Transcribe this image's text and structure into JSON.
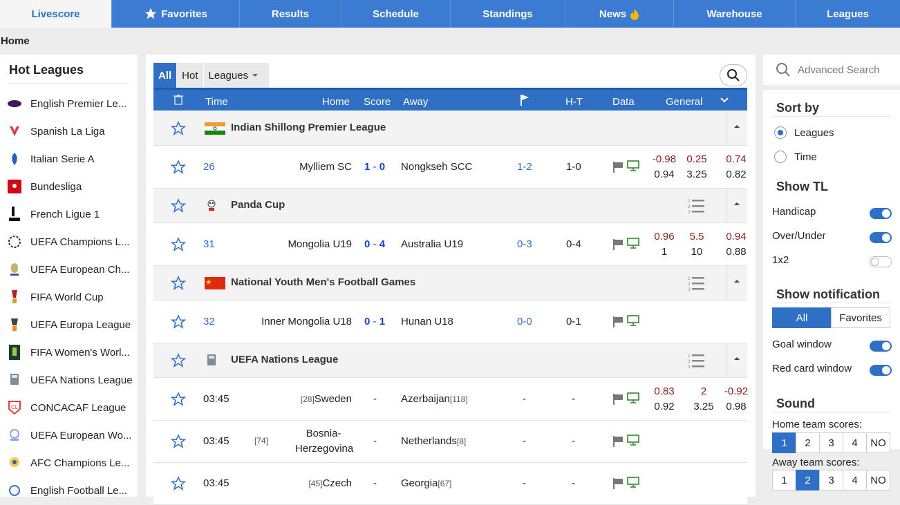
{
  "nav": {
    "tabs": [
      "Livescore",
      "Favorites",
      "Results",
      "Schedule",
      "Standings",
      "News",
      "Warehouse",
      "Leagues"
    ]
  },
  "breadcrumb": "Home",
  "sidebar": {
    "title": "Hot Leagues",
    "leagues": [
      "English Premier Le...",
      "Spanish La Liga",
      "Italian Serie A",
      "Bundesliga",
      "French Ligue 1",
      "UEFA Champions L...",
      "UEFA European Ch...",
      "FIFA World Cup",
      "UEFA Europa League",
      "FIFA Women's Worl...",
      "UEFA Nations League",
      "CONCACAF League",
      "UEFA European Wo...",
      "AFC Champions Le...",
      "English Football Le..."
    ]
  },
  "filters": {
    "all": "All",
    "hot": "Hot",
    "leagues": "Leagues"
  },
  "table_header": {
    "time": "Time",
    "home": "Home",
    "score": "Score",
    "away": "Away",
    "ht": "H-T",
    "data": "Data",
    "general": "General"
  },
  "groups": [
    {
      "name": "Indian Shillong Premier League",
      "match": {
        "time": "26",
        "home": "Mylliem SC",
        "score_home": "1",
        "score_away": "0",
        "dash": "-",
        "away": "Nongkseh SCC",
        "corner": "1-2",
        "ht": "1-0",
        "odds": [
          [
            "-0.98",
            "0.25",
            "0.74"
          ],
          [
            "0.94",
            "3.25",
            "0.82"
          ]
        ]
      }
    },
    {
      "name": "Panda Cup",
      "match": {
        "time": "31",
        "home": "Mongolia U19",
        "score_home": "0",
        "score_away": "4",
        "dash": "-",
        "away": "Australia U19",
        "corner": "0-3",
        "ht": "0-4",
        "odds": [
          [
            "0.96",
            "5.5",
            "0.94"
          ],
          [
            "1",
            "10",
            "0.88"
          ]
        ]
      }
    },
    {
      "name": "National Youth Men's Football Games",
      "match": {
        "time": "32",
        "home": "Inner Mongolia U18",
        "score_home": "0",
        "score_away": "1",
        "dash": "-",
        "away": "Hunan U18",
        "corner": "0-0",
        "ht": "0-1"
      }
    },
    {
      "name": "UEFA Nations League"
    }
  ],
  "nations_matches": [
    {
      "time": "03:45",
      "home_rank": "[28]",
      "home": "Sweden",
      "score": "-",
      "away": "Azerbaijan",
      "away_rank": "[118]",
      "corner": "-",
      "ht": "-",
      "odds": [
        [
          "0.83",
          "2",
          "-0.92"
        ],
        [
          "0.92",
          "3.25",
          "0.98"
        ]
      ]
    },
    {
      "time": "03:45",
      "home_rank": "[74]",
      "home_l1": "Bosnia-",
      "home_l2": "Herzegovina",
      "score": "-",
      "away": "Netherlands",
      "away_rank": "[8]",
      "corner": "-",
      "ht": "-"
    },
    {
      "time": "03:45",
      "home_rank": "[45]",
      "home": "Czech",
      "score": "-",
      "away": "Georgia",
      "away_rank": "[67]",
      "corner": "-",
      "ht": "-"
    }
  ],
  "right": {
    "search_placeholder": "Advanced Search",
    "sort_by": "Sort by",
    "sort_leagues": "Leagues",
    "sort_time": "Time",
    "show_tl": "Show TL",
    "handicap": "Handicap",
    "over_under": "Over/Under",
    "one_x_two": "1x2",
    "show_notification": "Show notification",
    "notif_all": "All",
    "notif_favorites": "Favorites",
    "goal_window": "Goal window",
    "red_card_window": "Red card window",
    "sound": "Sound",
    "home_scores": "Home team scores:",
    "away_scores": "Away team scores:",
    "sound_opts": [
      "1",
      "2",
      "3",
      "4",
      "NO"
    ],
    "home_selected": "1",
    "away_selected": "2"
  },
  "colors": {
    "primary": "#3b7bd1",
    "header": "#2f6fc4",
    "score": "#1a3fcf",
    "odds_red": "#8a1a1a"
  }
}
